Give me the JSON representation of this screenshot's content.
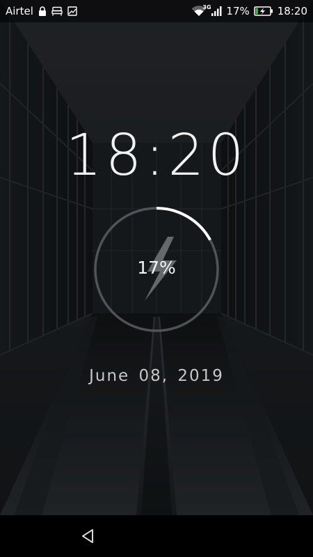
{
  "status_bar": {
    "carrier": "Airtel",
    "network_type": "3G",
    "battery_percent": "17%",
    "time": "18:20",
    "icons": [
      "lock-icon",
      "bed-icon",
      "image-icon",
      "wifi-icon",
      "signal-icon",
      "battery-charging-icon"
    ]
  },
  "lockscreen": {
    "clock": "18:20",
    "battery": {
      "label": "17%",
      "level": 0.17,
      "icon": "lightning-bolt-icon"
    },
    "date": "June 08, 2019"
  },
  "navigation": {
    "back_icon": "back-triangle-icon"
  },
  "colors": {
    "ring_track": "#5a5e62",
    "ring_fill": "#ffffff",
    "battery_fill": "#4caf50"
  }
}
